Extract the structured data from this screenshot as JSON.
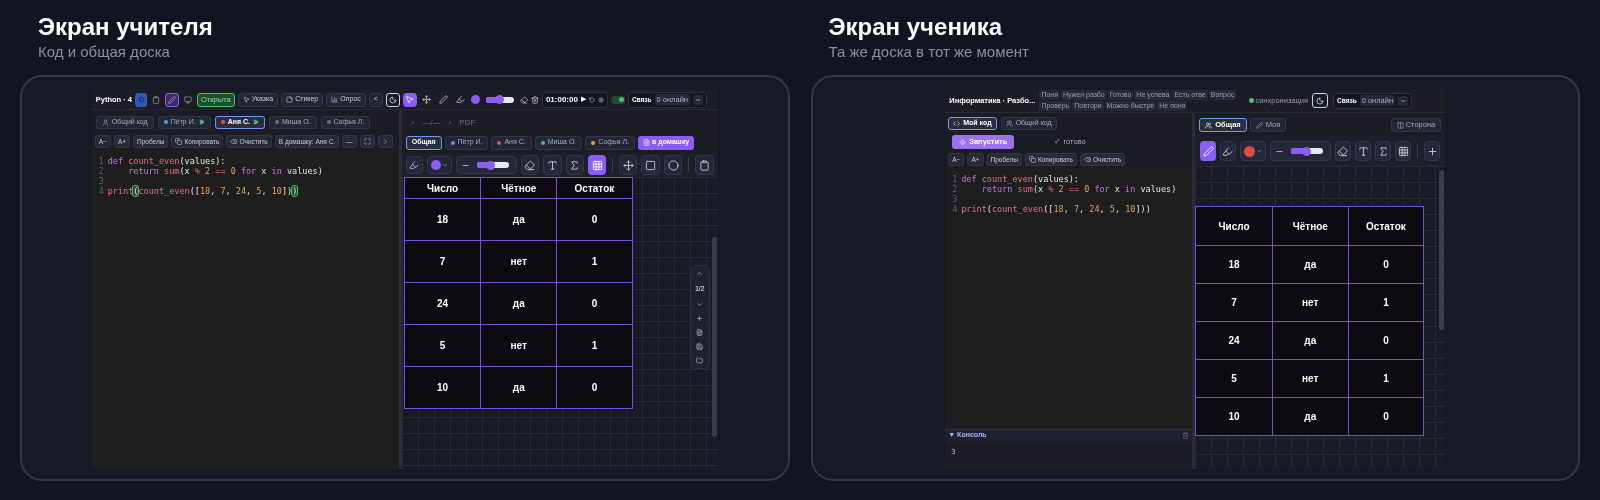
{
  "teacher": {
    "title": "Экран учителя",
    "subtitle": "Код и общая доска",
    "toolbar": {
      "doc_title": "Python · 4",
      "status_badge": "Открыта",
      "buttons": [
        {
          "label": "Указка",
          "kind": "pointer"
        },
        {
          "label": "Стикер",
          "kind": "sticker"
        },
        {
          "label": "Опрос",
          "kind": "poll"
        }
      ],
      "collapse": "<",
      "tools": [
        {
          "kind": "cursor",
          "selected": true
        },
        {
          "kind": "move",
          "selected": false
        },
        {
          "kind": "pen",
          "selected": false
        },
        {
          "kind": "highlighter",
          "selected": false
        }
      ],
      "pen": {
        "color": "#8b5cf6"
      },
      "stroke": {
        "level": 0.5
      },
      "timer": "01:00:00",
      "play": "▶",
      "sync_on": true,
      "connection": {
        "label": "Связь",
        "online": "0 онлайн"
      }
    },
    "code_tabs": [
      {
        "label": "Общий код",
        "kind": "shared",
        "selected": false
      },
      {
        "label": "Пётр И.",
        "kind": "student",
        "color": "#4a9df0",
        "live": true,
        "selected": false
      },
      {
        "label": "Аня С.",
        "kind": "student",
        "color": "#e25555",
        "live": true,
        "selected": true
      },
      {
        "label": "Миша О.",
        "kind": "student",
        "color": "#6b7080",
        "live": false,
        "selected": false
      },
      {
        "label": "Софья Л.",
        "kind": "student",
        "color": "#6b7080",
        "live": false,
        "selected": false
      }
    ],
    "editor_buttons": [
      {
        "kind": "text",
        "label": "A−"
      },
      {
        "kind": "text",
        "label": "A+"
      },
      {
        "kind": "text",
        "label": "Пробелы"
      },
      {
        "kind": "copy",
        "label": "Копировать"
      },
      {
        "kind": "clear",
        "label": "Очистить"
      },
      {
        "kind": "text",
        "label": "В домашку: Аня С."
      },
      {
        "kind": "text",
        "label": "—"
      },
      {
        "kind": "fullscreen"
      },
      {
        "kind": "more"
      }
    ],
    "code": [
      {
        "number": "1",
        "tokens": [
          {
            "kind": "kw",
            "t": "def "
          },
          {
            "kind": "fn",
            "t": "count_even"
          },
          {
            "kind": "plain",
            "t": "(values):"
          }
        ]
      },
      {
        "number": "2",
        "indent": true,
        "tokens": [
          {
            "kind": "kw",
            "t": "return "
          },
          {
            "kind": "fn",
            "t": "sum"
          },
          {
            "kind": "plain",
            "t": "(x "
          },
          {
            "kind": "op",
            "t": "% "
          },
          {
            "kind": "num",
            "t": "2 "
          },
          {
            "kind": "op",
            "t": "== "
          },
          {
            "kind": "num",
            "t": "0 "
          },
          {
            "kind": "kw",
            "t": "for "
          },
          {
            "kind": "plain",
            "t": "x "
          },
          {
            "kind": "kw",
            "t": "in "
          },
          {
            "kind": "plain",
            "t": "values)"
          }
        ]
      },
      {
        "number": "3"
      },
      {
        "number": "4",
        "tokens": [
          {
            "kind": "fn",
            "t": "print"
          },
          {
            "kind": "match",
            "t": "("
          },
          {
            "kind": "fn",
            "t": "count_even"
          },
          {
            "kind": "plain",
            "t": "(["
          },
          {
            "kind": "num",
            "t": "18"
          },
          {
            "kind": "plain",
            "t": ", "
          },
          {
            "kind": "num",
            "t": "7"
          },
          {
            "kind": "plain",
            "t": ", "
          },
          {
            "kind": "num",
            "t": "24"
          },
          {
            "kind": "plain",
            "t": ", "
          },
          {
            "kind": "num",
            "t": "5"
          },
          {
            "kind": "plain",
            "t": ", "
          },
          {
            "kind": "num",
            "t": "10"
          },
          {
            "kind": "plain",
            "t": "])"
          },
          {
            "kind": "match",
            "t": ")"
          }
        ]
      }
    ],
    "board": {
      "nav": {
        "prev": "‹",
        "page": "—/—",
        "next": "›",
        "label": "PDF"
      },
      "tabs": [
        {
          "label": "Общая",
          "selected": true
        },
        {
          "label": "Пётр И.",
          "color": "#4a9df0",
          "selected": false
        },
        {
          "label": "Аня С.",
          "color": "#e25555",
          "selected": false
        },
        {
          "label": "Миша О.",
          "color": "#4cc16b",
          "selected": false
        },
        {
          "label": "Софья Л.",
          "color": "#f0a040",
          "selected": false
        }
      ],
      "homework_button": "в домашку",
      "pen": {
        "color": "#8b5cf6"
      },
      "stroke": {
        "level": 0.45
      },
      "tools": [
        {
          "kind": "eraser",
          "selected": false
        },
        {
          "kind": "text",
          "selected": false
        },
        {
          "kind": "formula",
          "selected": false
        },
        {
          "kind": "table",
          "selected": true
        },
        {
          "kind": "divider"
        },
        {
          "kind": "move",
          "selected": false
        },
        {
          "kind": "rect",
          "selected": false
        },
        {
          "kind": "ellipse",
          "selected": false
        },
        {
          "kind": "divider"
        },
        {
          "kind": "sticker",
          "selected": false
        }
      ],
      "table": {
        "columns": [
          "Число",
          "Чётное",
          "Остаток"
        ],
        "rows": [
          [
            "18",
            "да",
            "0"
          ],
          [
            "7",
            "нет",
            "1"
          ],
          [
            "24",
            "да",
            "0"
          ],
          [
            "5",
            "нет",
            "1"
          ],
          [
            "10",
            "да",
            "0"
          ]
        ]
      },
      "pager": "1/2"
    }
  },
  "student": {
    "title": "Экран ученика",
    "subtitle": "Та же доска в тот же момент",
    "toolbar": {
      "doc_title": "Информатика · Разбо...",
      "reactions": [
        "Поня",
        "Нужен разбо",
        "Готово",
        "Не успева",
        "Есть отве",
        "Вопрос",
        "Проверь",
        "Повтори",
        "Можно быстре",
        "Не поня"
      ],
      "sync": "синхронизация",
      "connection": {
        "label": "Связь",
        "online": "0 онлайн"
      }
    },
    "code_tabs": [
      {
        "label": "Мой код",
        "kind": "code",
        "selected": true
      },
      {
        "label": "Общий код",
        "kind": "shared",
        "selected": false
      }
    ],
    "run_button": "Запустить",
    "run_status": "✓ готово",
    "editor_buttons": [
      {
        "kind": "text",
        "label": "A−"
      },
      {
        "kind": "text",
        "label": "A+"
      },
      {
        "kind": "text",
        "label": "Пробелы"
      },
      {
        "kind": "copy",
        "label": "Копировать"
      },
      {
        "kind": "clear",
        "label": "Очистить"
      }
    ],
    "code": [
      {
        "number": "1",
        "tokens": [
          {
            "kind": "kw",
            "t": "def "
          },
          {
            "kind": "fn",
            "t": "count_even"
          },
          {
            "kind": "plain",
            "t": "(values):"
          }
        ]
      },
      {
        "number": "2",
        "indent": true,
        "tokens": [
          {
            "kind": "kw",
            "t": "return "
          },
          {
            "kind": "fn",
            "t": "sum"
          },
          {
            "kind": "plain",
            "t": "(x "
          },
          {
            "kind": "op",
            "t": "% "
          },
          {
            "kind": "num",
            "t": "2 "
          },
          {
            "kind": "op",
            "t": "== "
          },
          {
            "kind": "num",
            "t": "0 "
          },
          {
            "kind": "kw",
            "t": "for "
          },
          {
            "kind": "plain",
            "t": "x "
          },
          {
            "kind": "kw",
            "t": "in "
          },
          {
            "kind": "plain",
            "t": "values)"
          }
        ]
      },
      {
        "number": "3"
      },
      {
        "number": "4",
        "tokens": [
          {
            "kind": "fn",
            "t": "print"
          },
          {
            "kind": "plain",
            "t": "("
          },
          {
            "kind": "fn",
            "t": "count_even"
          },
          {
            "kind": "plain",
            "t": "(["
          },
          {
            "kind": "num",
            "t": "18"
          },
          {
            "kind": "plain",
            "t": ", "
          },
          {
            "kind": "num",
            "t": "7"
          },
          {
            "kind": "plain",
            "t": ", "
          },
          {
            "kind": "num",
            "t": "24"
          },
          {
            "kind": "plain",
            "t": ", "
          },
          {
            "kind": "num",
            "t": "5"
          },
          {
            "kind": "plain",
            "t": ", "
          },
          {
            "kind": "num",
            "t": "10"
          },
          {
            "kind": "plain",
            "t": "]))"
          }
        ]
      }
    ],
    "console": {
      "toggle": "▼",
      "title": "Консоль",
      "output": "3"
    },
    "board": {
      "tabs": [
        {
          "label": "Общая",
          "kind": "shared",
          "selected": true
        },
        {
          "label": "Моя",
          "kind": "mine",
          "selected": false
        }
      ],
      "side_button": "Сторона",
      "pen": {
        "color": "#e04848"
      },
      "stroke": {
        "level": 0.5
      },
      "tools": [
        {
          "kind": "pen",
          "selected": true
        },
        {
          "kind": "highlighter",
          "selected": false
        },
        {
          "kind": "color"
        },
        {
          "kind": "stroke"
        },
        {
          "kind": "eraser",
          "selected": false
        },
        {
          "kind": "text",
          "selected": false
        },
        {
          "kind": "formula",
          "selected": false
        },
        {
          "kind": "table",
          "selected": false
        },
        {
          "kind": "divider"
        },
        {
          "kind": "more",
          "selected": false
        }
      ],
      "table": {
        "columns": [
          "Число",
          "Чётное",
          "Остаток"
        ],
        "rows": [
          [
            "18",
            "да",
            "0"
          ],
          [
            "7",
            "нет",
            "1"
          ],
          [
            "24",
            "да",
            "0"
          ],
          [
            "5",
            "нет",
            "1"
          ],
          [
            "10",
            "да",
            "0"
          ]
        ]
      }
    }
  }
}
